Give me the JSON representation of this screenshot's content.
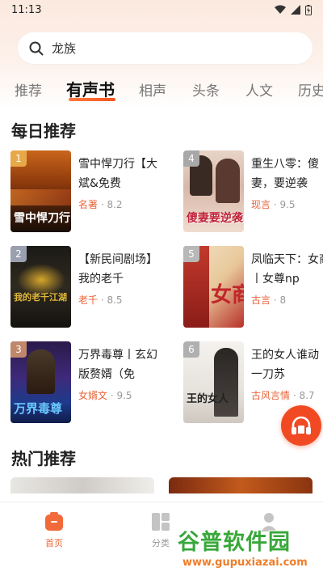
{
  "status_bar": {
    "time": "11:13"
  },
  "search": {
    "text": "龙族"
  },
  "tabs": [
    {
      "label": "推荐"
    },
    {
      "label": "有声书"
    },
    {
      "label": "相声"
    },
    {
      "label": "头条"
    },
    {
      "label": "人文"
    },
    {
      "label": "历史"
    }
  ],
  "daily": {
    "title": "每日推荐",
    "books": [
      {
        "rank": "1",
        "title": "雪中悍刀行【大斌&免费",
        "category": "名著",
        "score": "· 8.2",
        "cover_text": "雪中悍刀行"
      },
      {
        "rank": "2",
        "title": "【新民间剧场】我的老千",
        "category": "老千",
        "score": "· 8.5",
        "cover_text": "我的老千江湖"
      },
      {
        "rank": "3",
        "title": "万界毒尊丨玄幻版赘婿（免",
        "category": "女婿文",
        "score": "· 9.5",
        "cover_text": "万界毒尊"
      },
      {
        "rank": "4",
        "title": "重生八零：傻妻，要逆袭",
        "category": "现言",
        "score": "· 9.5",
        "cover_text": "傻妻要逆袭"
      },
      {
        "rank": "5",
        "title": "凤临天下：女商丨女尊np",
        "category": "古言",
        "score": "· 8",
        "cover_text": "女商"
      },
      {
        "rank": "6",
        "title": "王的女人谁动丨一刀苏",
        "category": "古风言情",
        "score": "· 8.7",
        "cover_text": "王的女人"
      }
    ]
  },
  "hot": {
    "title": "热门推荐"
  },
  "bottom_nav": [
    {
      "label": "首页"
    },
    {
      "label": "分类"
    },
    {
      "label": ""
    }
  ],
  "watermark": {
    "title": "谷普软件园",
    "url": "www.gupuxiazai.com"
  },
  "colors": {
    "accent": "#f14a23",
    "tab_accent": "#f06a3a"
  }
}
